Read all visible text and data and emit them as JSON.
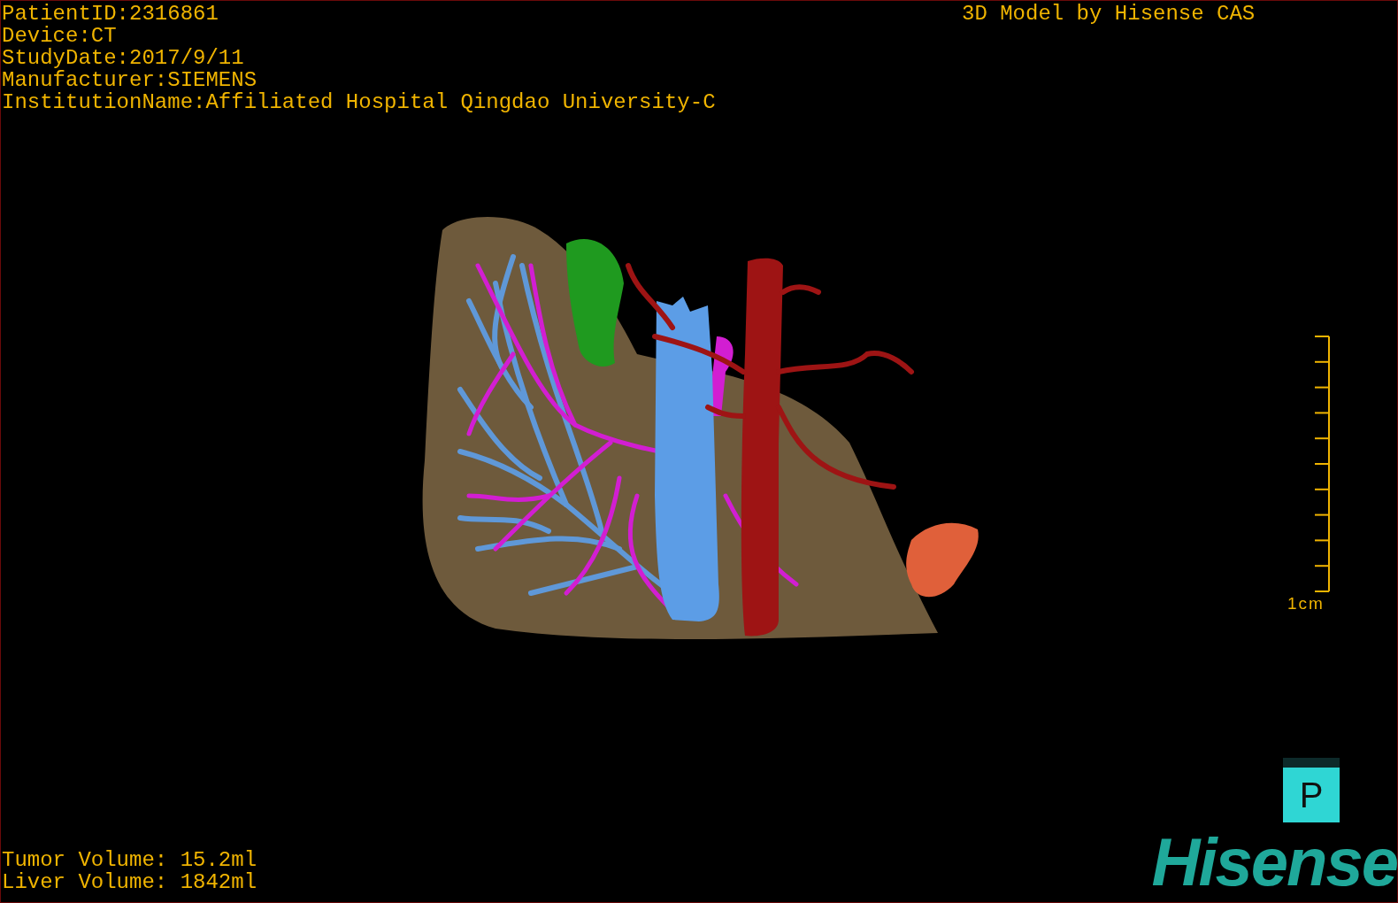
{
  "study_info": [
    "PatientID:2316861",
    "Device:CT",
    "StudyDate:2017/9/11",
    "Manufacturer:SIEMENS",
    "InstitutionName:Affiliated Hospital Qingdao University-C"
  ],
  "title": "3D Model by Hisense CAS",
  "scale_bar": {
    "label": "1cm"
  },
  "orientation_marker": {
    "label": "P"
  },
  "volumes": [
    "Tumor Volume: 15.2ml",
    "Liver Volume: 1842ml"
  ],
  "logo": "Hisense"
}
